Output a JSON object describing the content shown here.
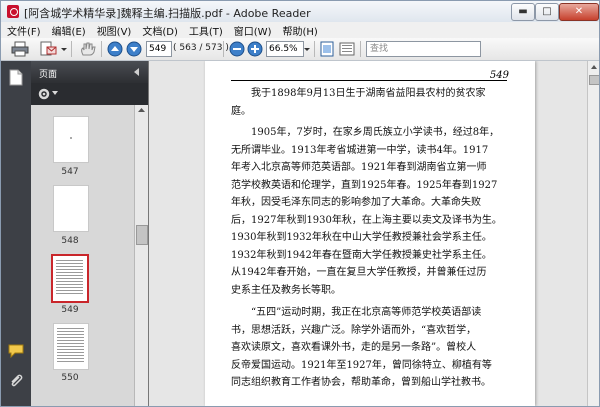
{
  "window": {
    "title": "[阿含城学术精华录]魏释主编.扫描版.pdf - Adobe Reader"
  },
  "menu": [
    "文件(F)",
    "编辑(E)",
    "视图(V)",
    "文档(D)",
    "工具(T)",
    "窗口(W)",
    "帮助(H)"
  ],
  "toolbar": {
    "page_input": "549",
    "page_count": "( 563 / 573 )",
    "zoom": "66.5%",
    "search_placeholder": "查找"
  },
  "panel": {
    "title": "页面"
  },
  "thumbnails": [
    {
      "label": "547",
      "selected": false
    },
    {
      "label": "548",
      "selected": false
    },
    {
      "label": "549",
      "selected": true
    },
    {
      "label": "550",
      "selected": false
    }
  ],
  "document": {
    "page_number": "549",
    "lines": [
      "我于1898年9月13日生于湖南省益阳县农村的贫农家",
      "庭。",
      "1905年，7岁时，在家乡周氏族立小学读书，经过8年，",
      "无所谓毕业。1913年考省城进第一中学，读书4年。1917",
      "年考入北京高等师范英语部。1921年春到湖南省立第一师",
      "范学校教英语和伦理学，直到1925年春。1925年春到1927",
      "年秋，因受毛泽东同志的影响参加了大革命。大革命失败",
      "后，1927年秋到1930年秋，在上海主要以卖文及译书为生。",
      "1930年秋到1932年秋在中山大学任教授兼社会学系主任。",
      "1932年秋到1942年春在暨南大学任教授兼史社学系主任。",
      "从1942年春开始，一直在复旦大学任教授，并曾兼任过历",
      "史系主任及教务长等职。",
      "“五四”运动时期，我正在北京高等师范学校英语部读",
      "书，思想活跃，兴趣广泛。除学外语而外，“喜欢哲学，",
      "喜欢读原文，喜欢看课外书，走的是另一条路”。曾校人",
      "反帝爱国运动。1921年至1927年，曾同徐特立、柳植有等",
      "同志组织教育工作者协会，帮助革命，曾到船山学社教书。"
    ]
  }
}
